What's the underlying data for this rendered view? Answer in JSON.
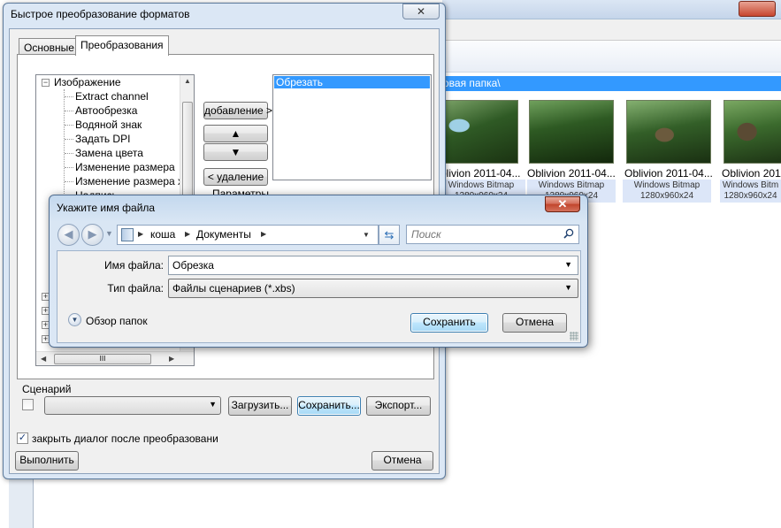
{
  "background": {
    "path_text": "овая папка\\",
    "thumbnails": [
      {
        "caption": "blivion 2011-04...",
        "type": "Windows Bitmap",
        "size": "1280x960x24"
      },
      {
        "caption": "Oblivion 2011-04...",
        "type": "Windows Bitmap",
        "size": "1280x960x24"
      },
      {
        "caption": "Oblivion 2011-04...",
        "type": "Windows Bitmap",
        "size": "1280x960x24"
      },
      {
        "caption": "Oblivion 2011",
        "type": "Windows Bitm",
        "size": "1280x960x24"
      }
    ]
  },
  "main_dialog": {
    "title": "Быстрое преобразование форматов",
    "tabs": [
      "Основные",
      "Преобразования"
    ],
    "active_tab": "Преобразования",
    "tree": {
      "root": "Изображение",
      "items": [
        "Extract channel",
        "Автообрезка",
        "Водяной знак",
        "Задать DPI",
        "Замена цвета",
        "Изменение размера",
        "Изменение размера хо",
        "Надпись"
      ],
      "scroll_grip": "III"
    },
    "buttons": {
      "add": "добавление >",
      "up": "▲",
      "down": "▼",
      "remove": "< удаление"
    },
    "operations": [
      "Обрезать"
    ],
    "params_label": "Параметры",
    "scenario": {
      "label": "Сценарий",
      "load": "Загрузить...",
      "save": "Сохранить...",
      "export": "Экспорт..."
    },
    "close_after": {
      "label": "закрыть диалог после преобразовани",
      "checked": true
    },
    "run": "Выполнить",
    "cancel": "Отмена"
  },
  "save_dialog": {
    "title": "Укажите имя файла",
    "breadcrumb": [
      "коша",
      "Документы"
    ],
    "search_placeholder": "Поиск",
    "filename_label": "Имя файла:",
    "filename_value": "Обрезка",
    "filetype_label": "Тип файла:",
    "filetype_value": "Файлы сценариев (*.xbs)",
    "browse_folders": "Обзор папок",
    "save": "Сохранить",
    "cancel": "Отмена"
  }
}
